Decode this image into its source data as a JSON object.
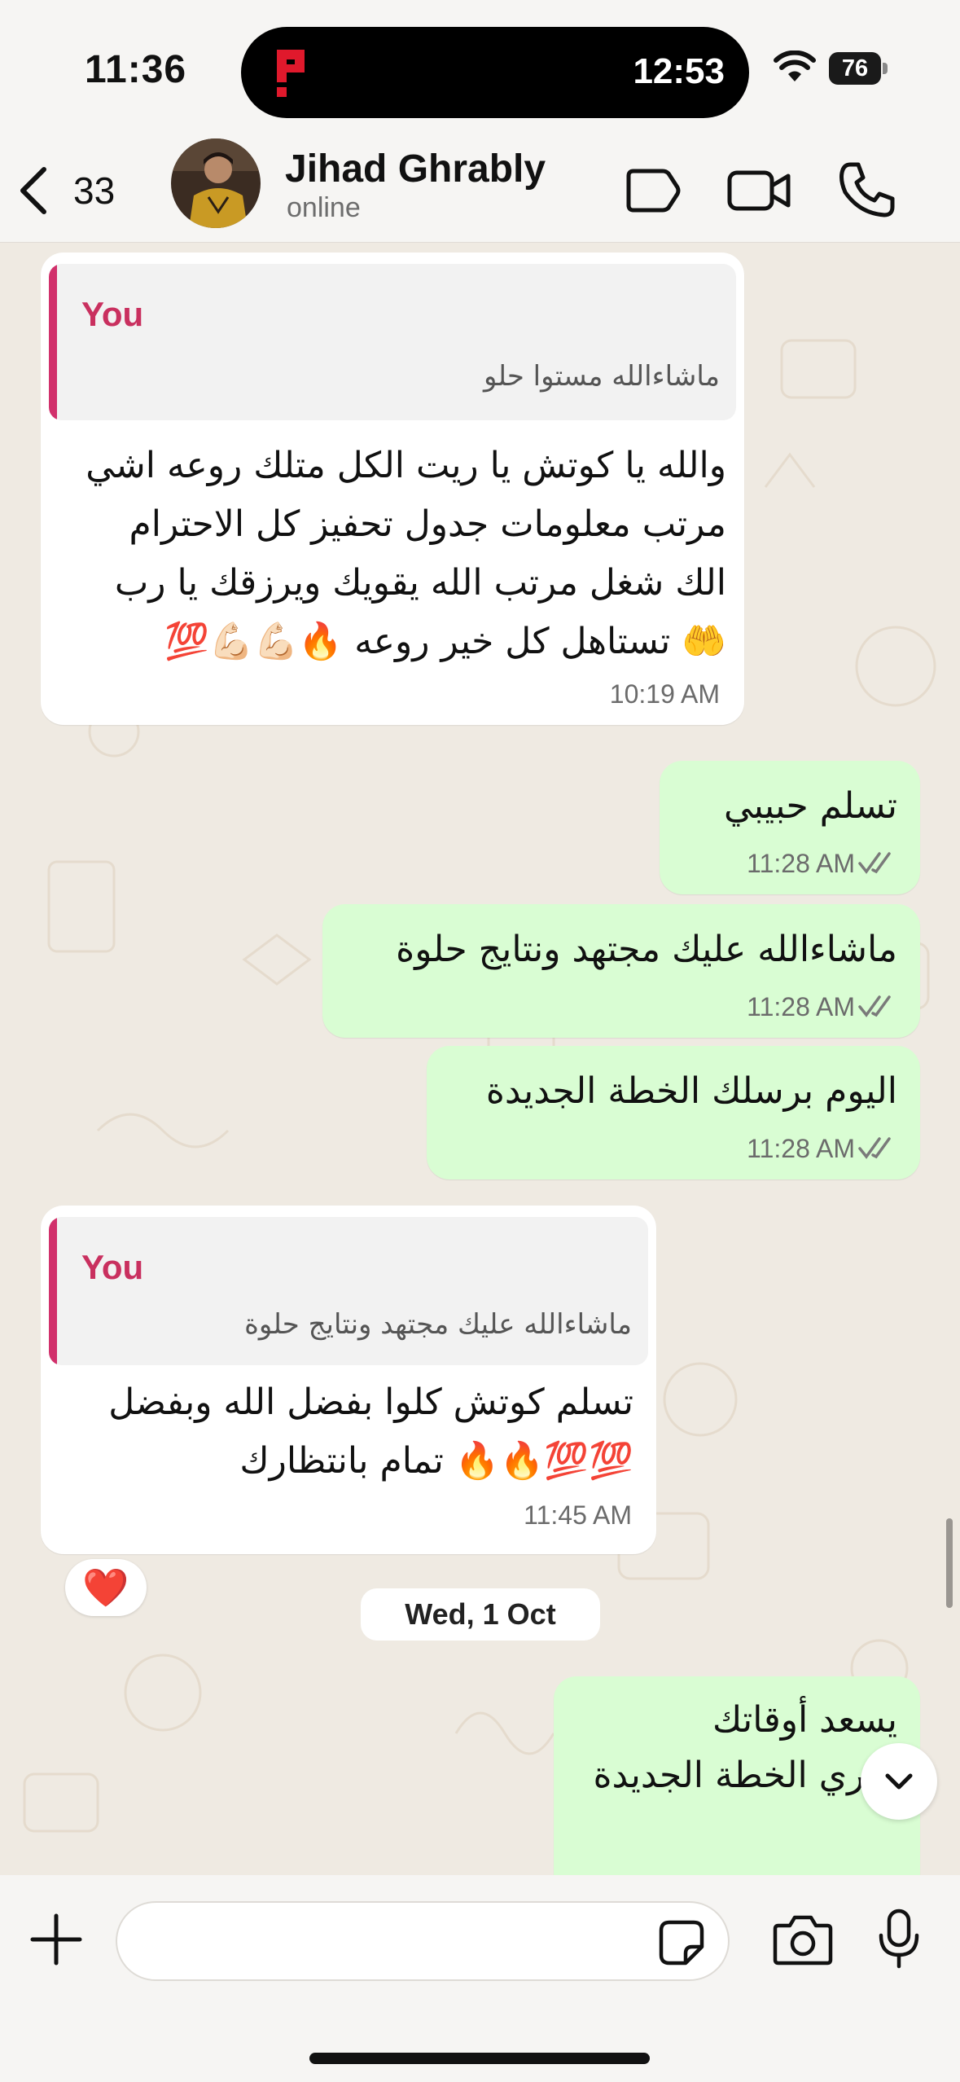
{
  "status_bar": {
    "time": "11:36",
    "island_time": "12:53",
    "battery": "76"
  },
  "header": {
    "back_count": "33",
    "contact_name": "Jihad Ghrably",
    "contact_status": "online"
  },
  "messages": [
    {
      "direction": "incoming",
      "quote_author": "You",
      "quote_text": "ماشاءالله مستوا حلو",
      "lines": [
        "والله يا كوتش يا ريت الكل متلك روعه اشي",
        "مرتب معلومات جدول تحفيز كل الاحترام",
        "الك شغل مرتب الله يقويك ويرزقك يا رب",
        "🤲 تستاهل كل خير روعه 🔥💪🏻💪🏻💯"
      ],
      "time": "10:19 AM"
    },
    {
      "direction": "outgoing",
      "text": "تسلم حبيبي",
      "time": "11:28 AM"
    },
    {
      "direction": "outgoing",
      "text": "ماشاءالله عليك مجتهد ونتايج حلوة",
      "time": "11:28 AM"
    },
    {
      "direction": "outgoing",
      "text": "اليوم برسلك الخطة الجديدة",
      "time": "11:28 AM"
    },
    {
      "direction": "incoming",
      "quote_author": "You",
      "quote_text": "ماشاءالله عليك مجتهد ونتايج حلوة",
      "lines": [
        "تسلم كوتش كلوا بفضل الله وبفضل",
        "💯💯🔥🔥 تمام بانتظارك"
      ],
      "time": "11:45 AM",
      "reaction": "❤️"
    },
    {
      "direction": "outgoing",
      "text": "يسعد أوقاتك",
      "text2": "جاري الخطة الجديدة"
    }
  ],
  "date_separator": "Wed, 1 Oct",
  "colors": {
    "outgoing_bubble": "#d9fdd3",
    "incoming_bubble": "#ffffff",
    "chat_background": "#efeae2",
    "quote_accent": "#c9305f"
  }
}
